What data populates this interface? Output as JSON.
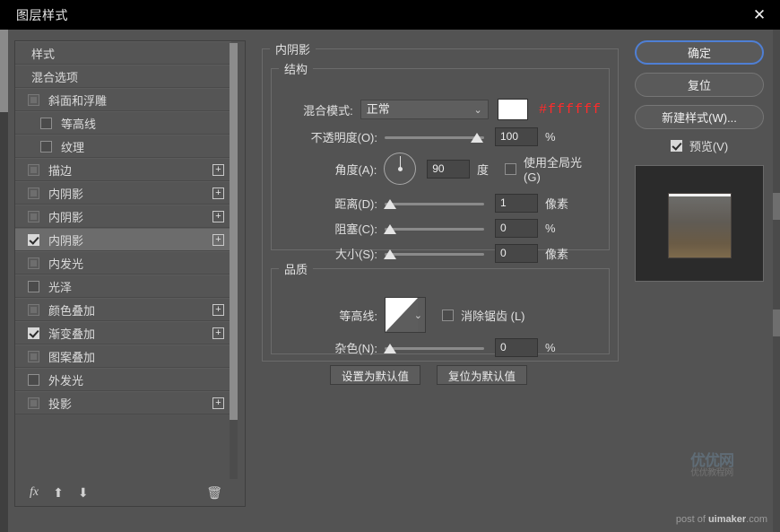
{
  "window": {
    "title": "图层样式",
    "close_icon": "close-icon"
  },
  "sidebar": {
    "items": [
      {
        "label": "样式",
        "checkbox": "none",
        "plus": false,
        "indent": false,
        "selected": false
      },
      {
        "label": "混合选项",
        "checkbox": "none",
        "plus": false,
        "indent": false,
        "selected": false
      },
      {
        "label": "斜面和浮雕",
        "checkbox": "dim",
        "plus": false,
        "indent": false,
        "selected": false
      },
      {
        "label": "等高线",
        "checkbox": "unchecked",
        "plus": false,
        "indent": true,
        "selected": false
      },
      {
        "label": "纹理",
        "checkbox": "unchecked",
        "plus": false,
        "indent": true,
        "selected": false
      },
      {
        "label": "描边",
        "checkbox": "dim",
        "plus": true,
        "indent": false,
        "selected": false
      },
      {
        "label": "内阴影",
        "checkbox": "dim",
        "plus": true,
        "indent": false,
        "selected": false
      },
      {
        "label": "内阴影",
        "checkbox": "dim",
        "plus": true,
        "indent": false,
        "selected": false
      },
      {
        "label": "内阴影",
        "checkbox": "checked",
        "plus": true,
        "indent": false,
        "selected": true
      },
      {
        "label": "内发光",
        "checkbox": "dim",
        "plus": false,
        "indent": false,
        "selected": false
      },
      {
        "label": "光泽",
        "checkbox": "unchecked",
        "plus": false,
        "indent": false,
        "selected": false
      },
      {
        "label": "颜色叠加",
        "checkbox": "dim",
        "plus": true,
        "indent": false,
        "selected": false
      },
      {
        "label": "渐变叠加",
        "checkbox": "checked",
        "plus": true,
        "indent": false,
        "selected": false
      },
      {
        "label": "图案叠加",
        "checkbox": "dim",
        "plus": false,
        "indent": false,
        "selected": false
      },
      {
        "label": "外发光",
        "checkbox": "unchecked",
        "plus": false,
        "indent": false,
        "selected": false
      },
      {
        "label": "投影",
        "checkbox": "dim",
        "plus": true,
        "indent": false,
        "selected": false
      }
    ],
    "toolbar": {
      "fx_icon": "fx-icon",
      "up_icon": "move-up-icon",
      "down_icon": "move-down-icon",
      "trash_icon": "trash-icon"
    }
  },
  "main": {
    "panel_title": "内阴影",
    "structure": {
      "legend": "结构",
      "blend_mode_label": "混合模式:",
      "blend_mode_value": "正常",
      "color_hex": "#ffffff",
      "color_swatch": "#ffffff",
      "opacity_label": "不透明度(O):",
      "opacity_value": "100",
      "opacity_unit": "%",
      "angle_label": "角度(A):",
      "angle_value": "90",
      "angle_unit": "度",
      "global_light_label": "使用全局光 (G)",
      "global_light_checked": false,
      "distance_label": "距离(D):",
      "distance_value": "1",
      "distance_unit": "像素",
      "choke_label": "阻塞(C):",
      "choke_value": "0",
      "choke_unit": "%",
      "size_label": "大小(S):",
      "size_value": "0",
      "size_unit": "像素"
    },
    "quality": {
      "legend": "品质",
      "contour_label": "等高线:",
      "antialias_label": "消除锯齿 (L)",
      "antialias_checked": false,
      "noise_label": "杂色(N):",
      "noise_value": "0",
      "noise_unit": "%"
    },
    "buttons": {
      "set_default": "设置为默认值",
      "reset_default": "复位为默认值"
    }
  },
  "right": {
    "ok": "确定",
    "reset": "复位",
    "new_style": "新建样式(W)...",
    "preview_label": "预览(V)",
    "preview_checked": true,
    "accent_color": "#4f7fd4"
  },
  "watermark": {
    "logo_line1": "优优网",
    "logo_line2": "优优教程网",
    "credit_prefix": "post of ",
    "credit_brand": "uimaker",
    "credit_suffix": ".com"
  }
}
